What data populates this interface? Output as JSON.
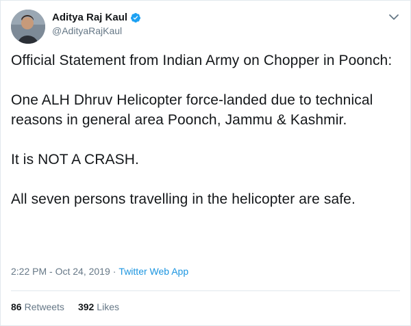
{
  "tweet": {
    "author": {
      "display_name": "Aditya Raj Kaul",
      "handle": "@AdityaRajKaul",
      "verified": true
    },
    "paragraphs": [
      "Official Statement from Indian Army on Chopper in Poonch:",
      "One ALH Dhruv Helicopter force-landed due to technical reasons in general area Poonch, Jammu & Kashmir.",
      "It is NOT A CRASH.",
      "All seven persons travelling in the helicopter are safe."
    ],
    "timestamp": "2:22 PM - Oct 24, 2019",
    "separator": "·",
    "source": "Twitter Web App",
    "retweets": {
      "count": "86",
      "label": "Retweets"
    },
    "likes": {
      "count": "392",
      "label": "Likes"
    }
  },
  "colors": {
    "text": "#14171a",
    "secondary": "#657786",
    "link": "#1b95e0",
    "verified": "#1da1f2",
    "border": "#e1e8ed"
  },
  "icons": {
    "verified": "verified-badge-icon",
    "menu": "chevron-down-icon"
  }
}
